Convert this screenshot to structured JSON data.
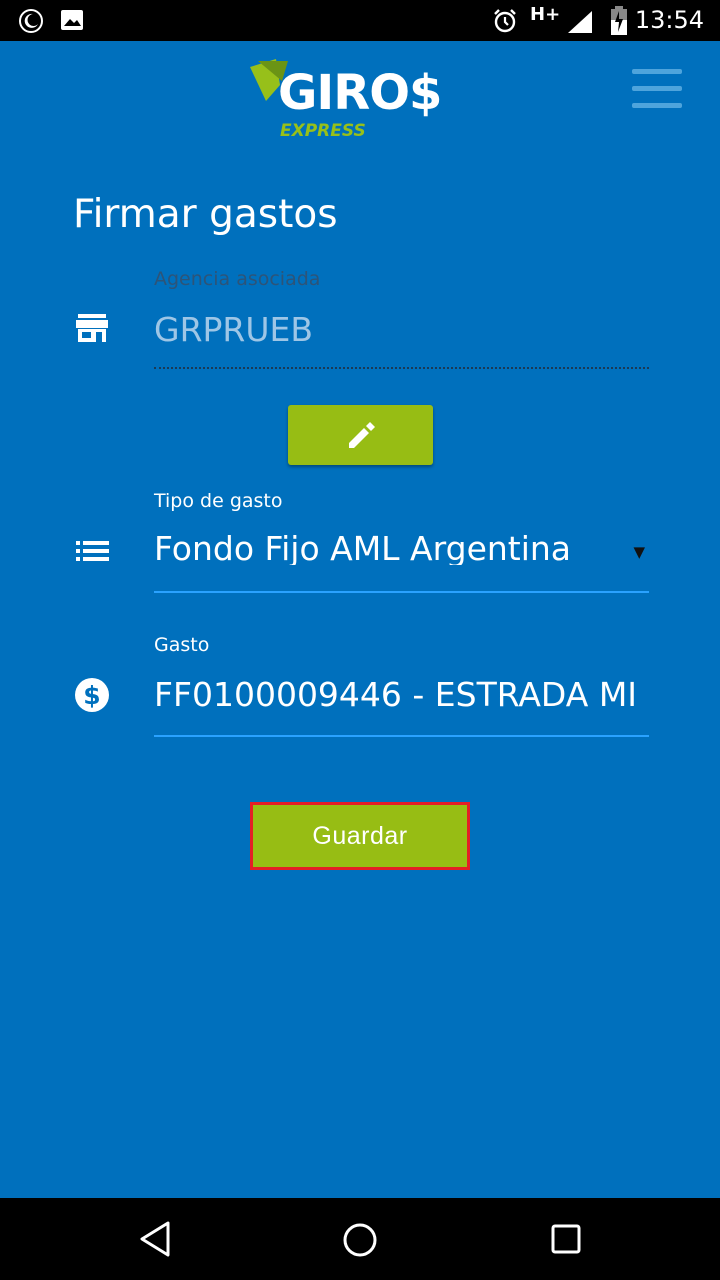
{
  "status_bar": {
    "time": "13:54",
    "network": "H+",
    "icons": [
      "moon-icon",
      "image-icon",
      "alarm-icon",
      "signal-icon",
      "battery-icon"
    ]
  },
  "header": {
    "logo_main": "GIRO$",
    "logo_sub": "EXPRESS",
    "menu_icon": "hamburger-menu-icon"
  },
  "page": {
    "title": "Firmar gastos"
  },
  "form": {
    "agency": {
      "label": "Agencia asociada",
      "value": "GRPRUEB",
      "icon": "store-icon"
    },
    "edit_icon": "pencil-icon",
    "expense_type": {
      "label": "Tipo de gasto",
      "value": "Fondo Fijo AML Argentina",
      "icon": "list-icon"
    },
    "expense": {
      "label": "Gasto",
      "value": "FF0100009446 - ESTRADA MI",
      "icon": "dollar-icon"
    },
    "save_label": "Guardar"
  },
  "colors": {
    "background": "#0070bd",
    "accent_green": "#97bd14",
    "highlight_red": "#e41e26",
    "field_underline": "#2aa2ff"
  },
  "nav_bar": {
    "icons": [
      "back-icon",
      "home-icon",
      "recents-icon"
    ]
  }
}
